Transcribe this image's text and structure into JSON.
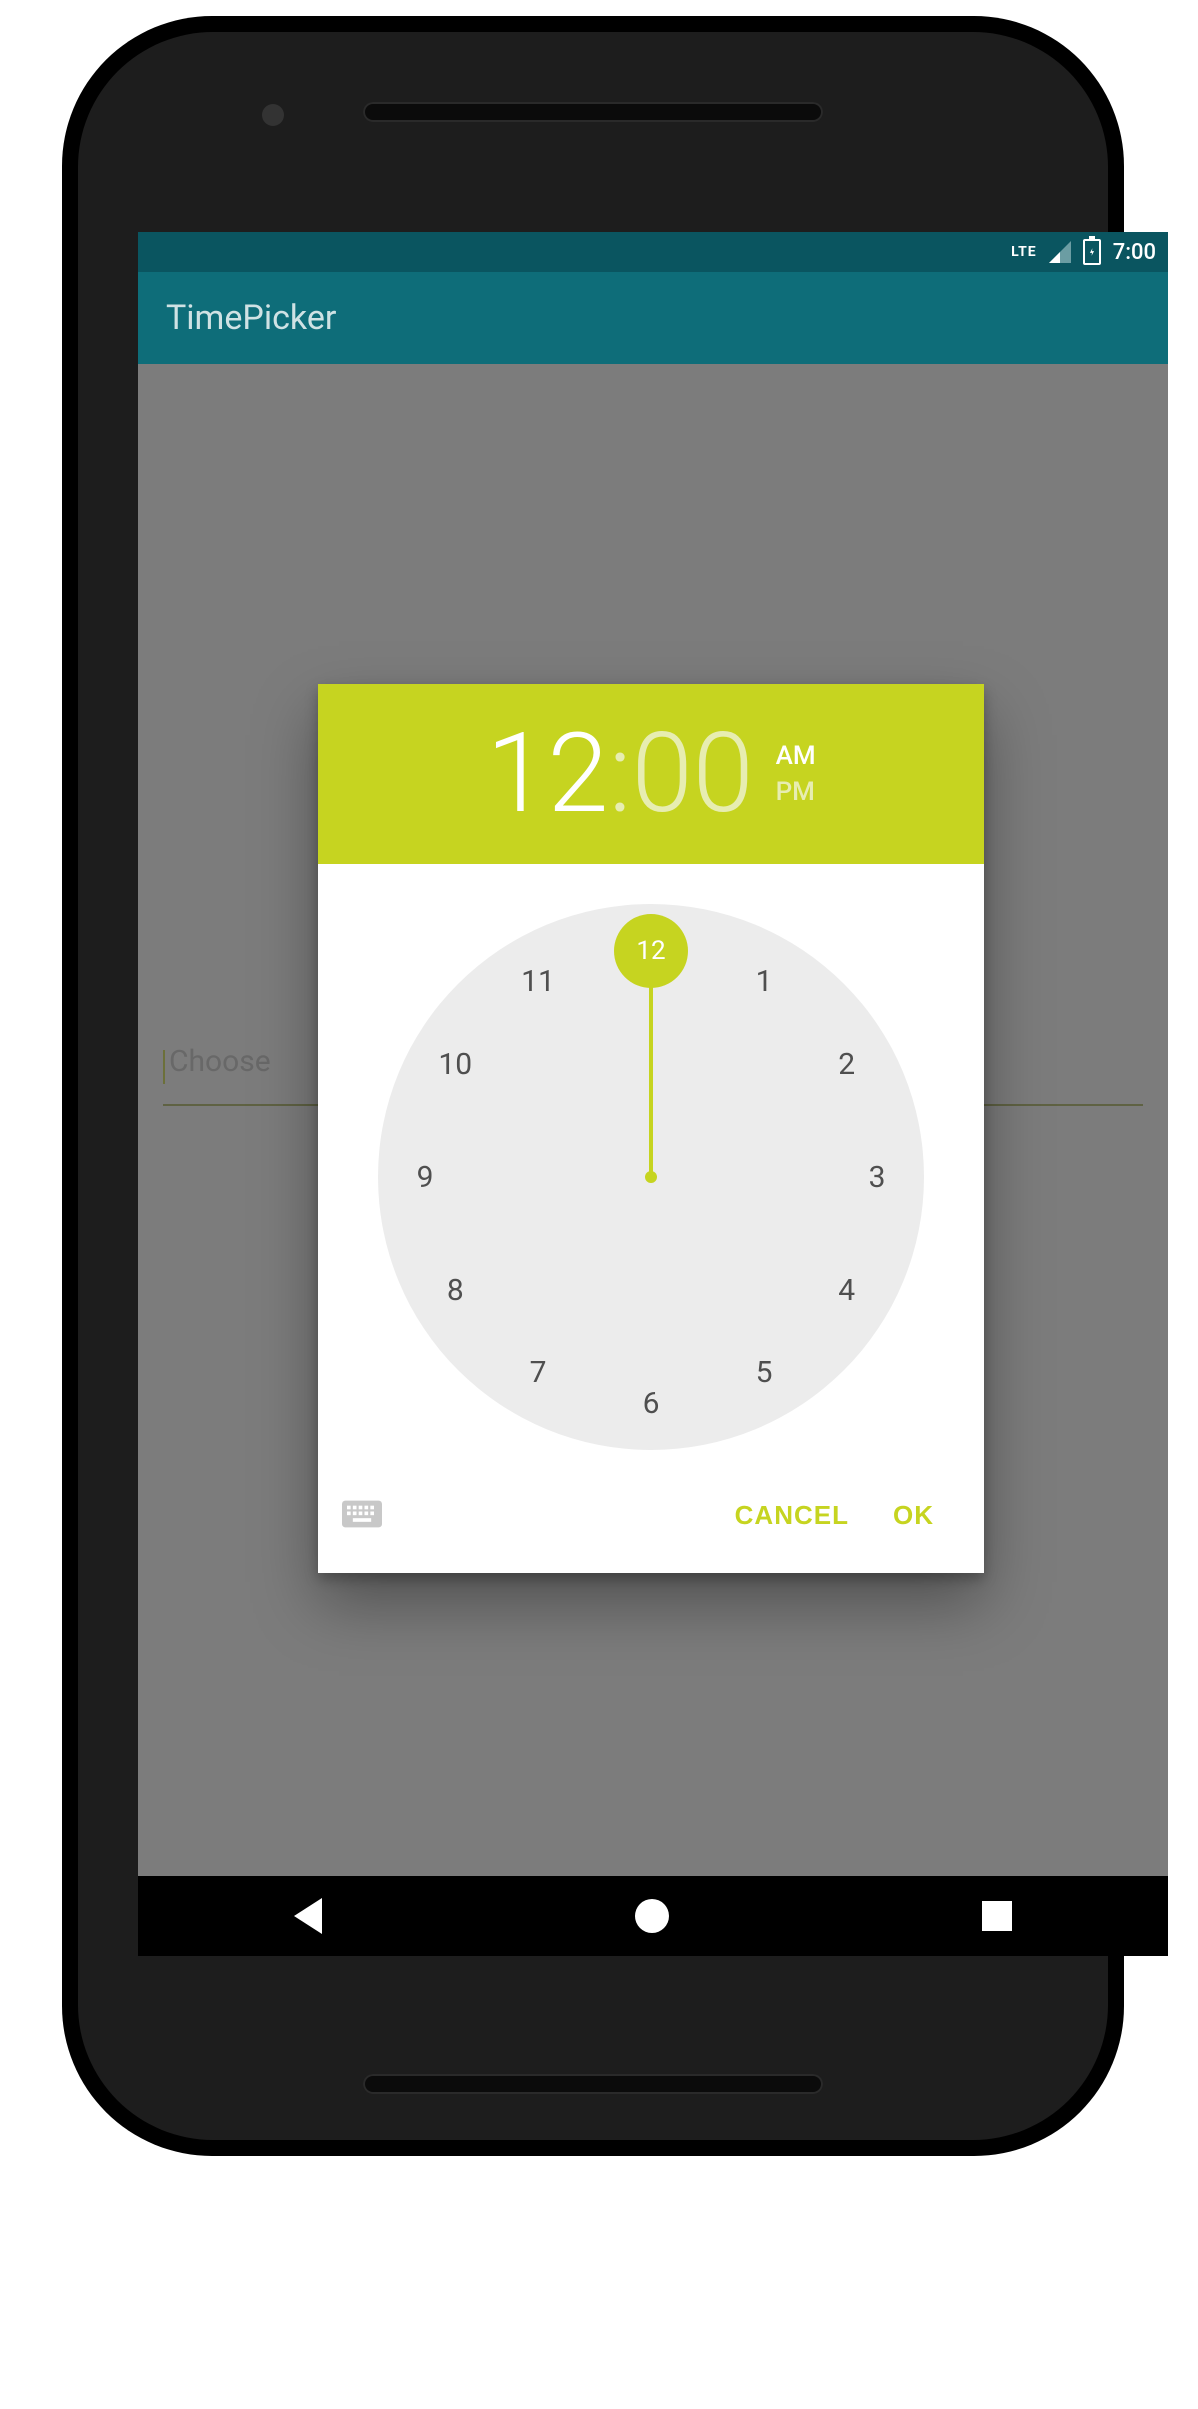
{
  "colors": {
    "accent": "#c6d420",
    "teal": "#0e6d79",
    "teal_dark": "#0a5560",
    "clock_bg": "#ececec"
  },
  "status_bar": {
    "network_label": "LTE",
    "signal_icon": "signal-triangle",
    "battery_icon": "battery-charging",
    "time": "7:00"
  },
  "app_bar": {
    "title": "TimePicker"
  },
  "background_field": {
    "placeholder": "Choose"
  },
  "dialog": {
    "time": {
      "hour": "12",
      "colon": ":",
      "minute": "00"
    },
    "ampm": {
      "am_label": "AM",
      "pm_label": "PM",
      "selected": "AM"
    },
    "clock": {
      "selected_hour": 12,
      "hand_angle_deg": 0,
      "numbers": [
        {
          "label": "12",
          "angle": 0
        },
        {
          "label": "1",
          "angle": 30
        },
        {
          "label": "2",
          "angle": 60
        },
        {
          "label": "3",
          "angle": 90
        },
        {
          "label": "4",
          "angle": 120
        },
        {
          "label": "5",
          "angle": 150
        },
        {
          "label": "6",
          "angle": 180
        },
        {
          "label": "7",
          "angle": 210
        },
        {
          "label": "8",
          "angle": 240
        },
        {
          "label": "9",
          "angle": 270
        },
        {
          "label": "10",
          "angle": 300
        },
        {
          "label": "11",
          "angle": 330
        }
      ]
    },
    "actions": {
      "keyboard_icon": "keyboard-icon",
      "cancel": "CANCEL",
      "ok": "OK"
    }
  },
  "nav_bar": {
    "back": "nav-back",
    "home": "nav-home",
    "recents": "nav-recents"
  }
}
